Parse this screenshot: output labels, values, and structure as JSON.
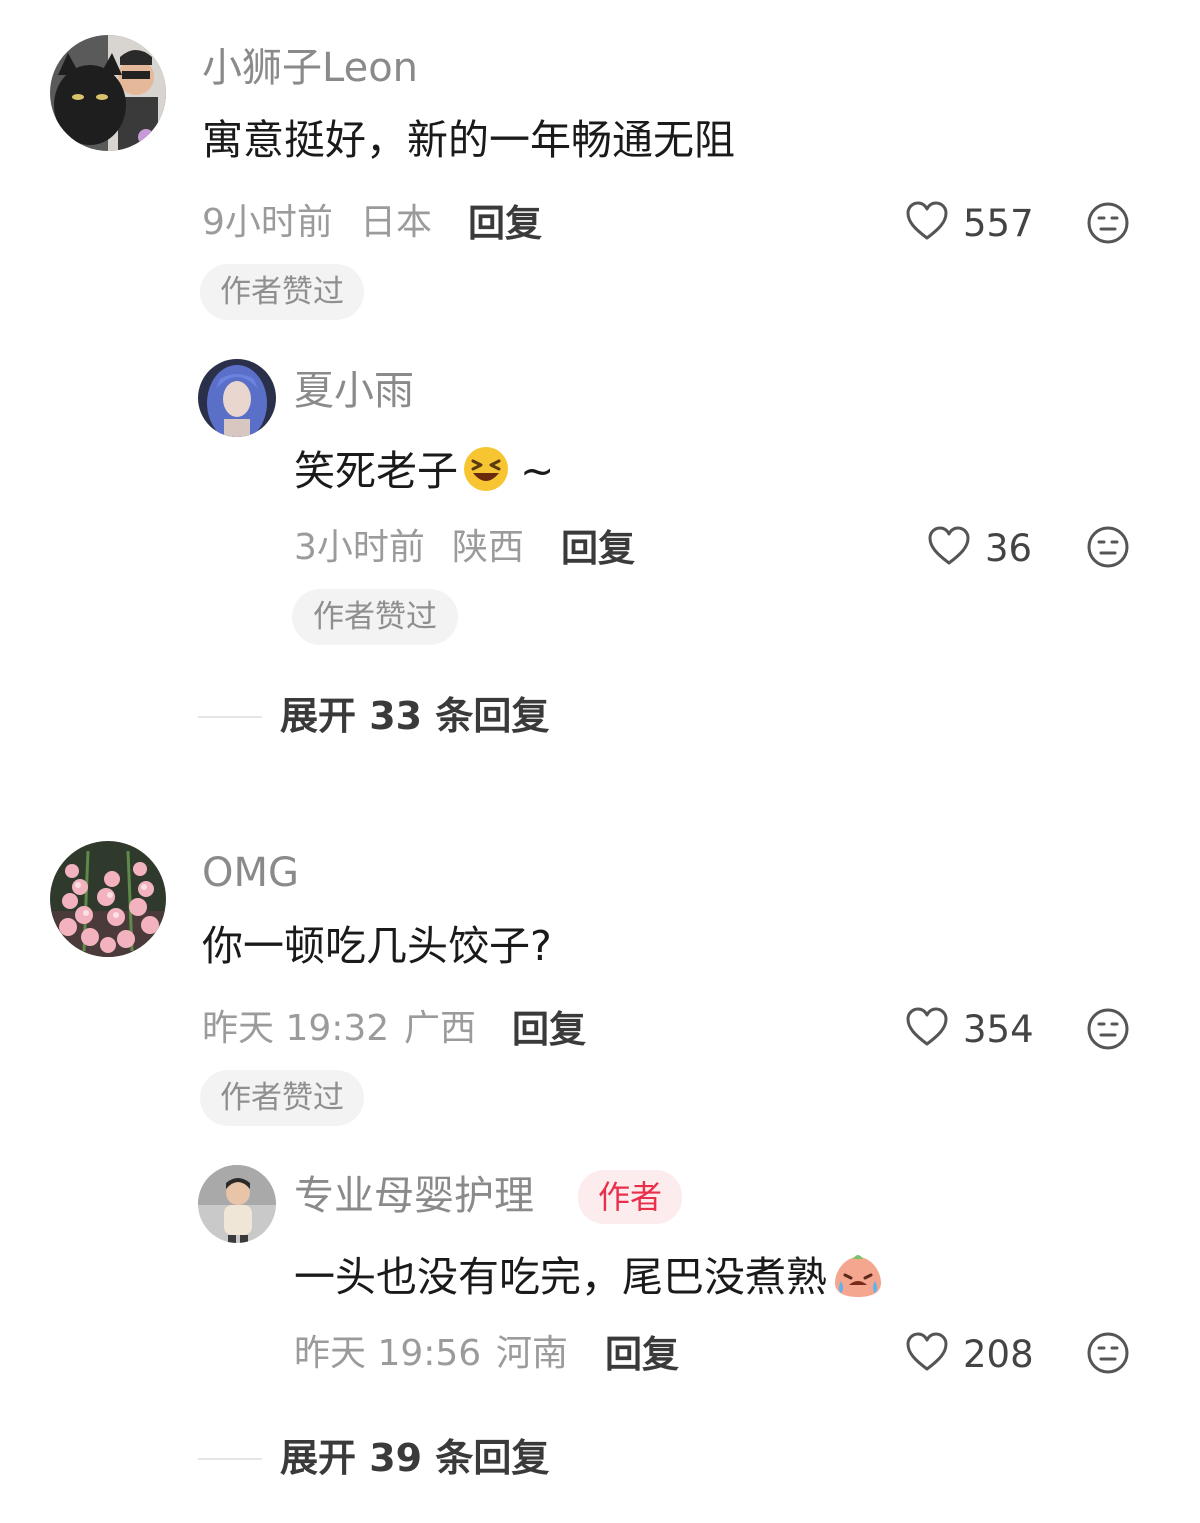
{
  "colors": {
    "background": "#ffffff",
    "username": "#8a8a8a",
    "content": "#1a1a1a",
    "meta": "#9b9b9b",
    "pill_bg": "#f3f3f3",
    "author_badge_bg": "#fdecee",
    "author_badge_text": "#e8304a"
  },
  "comments": [
    {
      "username": "小狮子Leon",
      "content": "寓意挺好，新的一年畅通无阻",
      "time": "9小时前",
      "location": "日本",
      "reply_label": "回复",
      "likes": "557",
      "liked_by_author_label": "作者赞过",
      "avatar_icon": "cat-and-man-avatar",
      "replies": [
        {
          "username": "夏小雨",
          "content": "笑死老子",
          "content_suffix": "~",
          "emoji_icon": "laughing-face-emoji",
          "time": "3小时前",
          "location": "陕西",
          "reply_label": "回复",
          "likes": "36",
          "liked_by_author_label": "作者赞过",
          "avatar_icon": "blue-hair-girl-avatar"
        }
      ],
      "expand_label": "展开 33 条回复"
    },
    {
      "username": "OMG",
      "content": "你一顿吃几头饺子?",
      "time": "昨天 19:32",
      "location": "广西",
      "reply_label": "回复",
      "likes": "354",
      "liked_by_author_label": "作者赞过",
      "avatar_icon": "pink-flowers-avatar",
      "replies": [
        {
          "username": "专业母婴护理",
          "author_badge": "作者",
          "content": "一头也没有吃完，尾巴没煮熟",
          "emoji_icon": "crying-dumpling-emoji",
          "time": "昨天 19:56",
          "location": "河南",
          "reply_label": "回复",
          "likes": "208",
          "avatar_icon": "child-photo-avatar"
        }
      ],
      "expand_label": "展开 39 条回复"
    }
  ]
}
